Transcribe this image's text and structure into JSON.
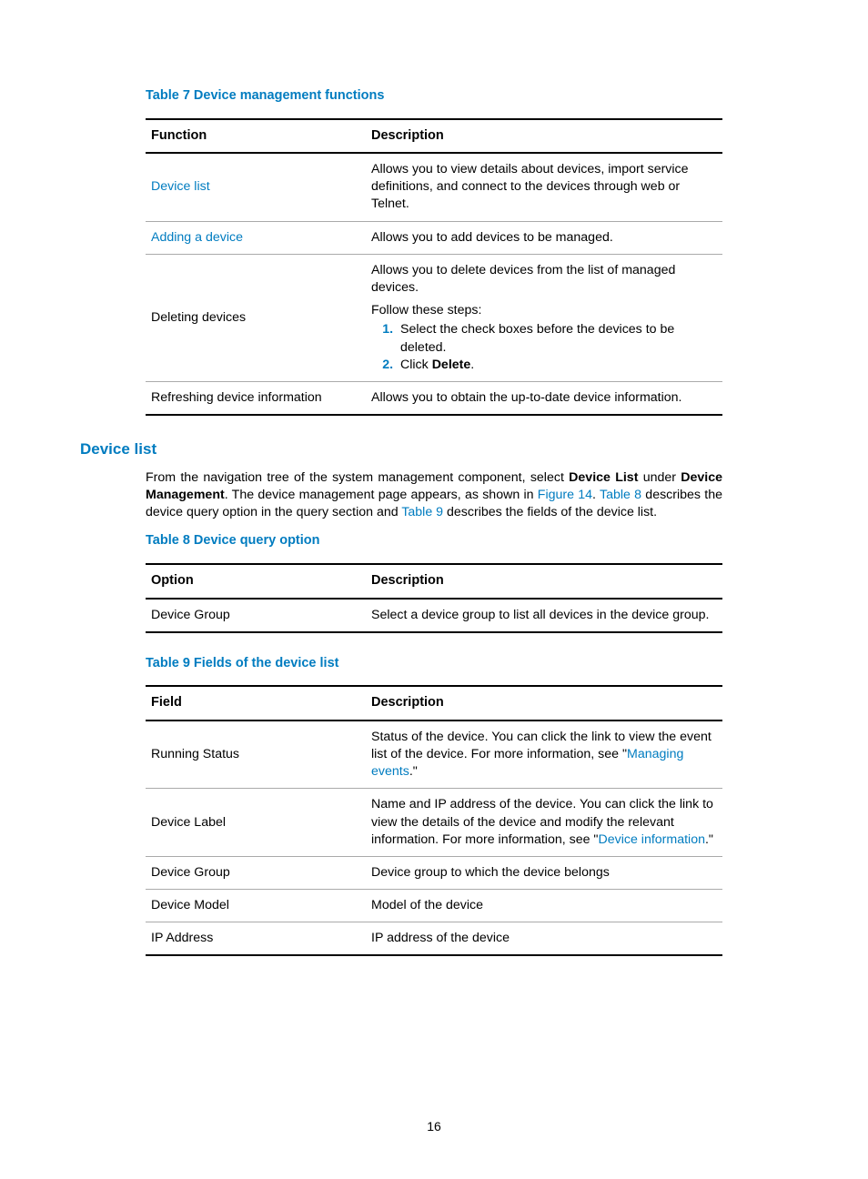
{
  "table7": {
    "caption": "Table 7 Device management functions",
    "headers": {
      "c1": "Function",
      "c2": "Description"
    },
    "rows": [
      {
        "func_link": "Device list",
        "desc": "Allows you to view details about devices, import service definitions, and connect to the devices through web or Telnet."
      },
      {
        "func_link": "Adding a device",
        "desc": "Allows you to add devices to be managed."
      },
      {
        "func_text": "Deleting devices",
        "desc1": "Allows you to delete devices from the list of managed devices.",
        "desc2": "Follow these steps:",
        "step1": "Select the check boxes before the devices to be deleted.",
        "step2_pre": "Click ",
        "step2_b": "Delete",
        "step2_post": "."
      },
      {
        "func_text": "Refreshing device information",
        "desc": "Allows you to obtain the up-to-date device information."
      }
    ]
  },
  "section_heading": "Device list",
  "para": {
    "t1": "From the navigation tree of the system management component, select ",
    "b1": "Device List",
    "t2": " under ",
    "b2": "Device Management",
    "t3": ". The device management page appears, as shown in ",
    "l1": "Figure 14",
    "t4": ". ",
    "l2": "Table 8",
    "t5": " describes the device query option in the query section and ",
    "l3": "Table 9",
    "t6": " describes the fields of the device list."
  },
  "table8": {
    "caption": "Table 8 Device query option",
    "headers": {
      "c1": "Option",
      "c2": "Description"
    },
    "rows": [
      {
        "opt": "Device Group",
        "desc": "Select a device group to list all devices in the device group."
      }
    ]
  },
  "table9": {
    "caption": "Table 9 Fields of the device list",
    "headers": {
      "c1": "Field",
      "c2": "Description"
    },
    "rows": [
      {
        "field": "Running Status",
        "d1": "Status of the device. You can click the link to view the event list of the device. For more information, see \"",
        "l1": "Managing events",
        "d2": ".\""
      },
      {
        "field": "Device Label",
        "d1": "Name and IP address of the device. You can click the link to view the details of the device and modify the relevant information. For more information, see \"",
        "l1": "Device information",
        "d2": ".\""
      },
      {
        "field": "Device Group",
        "desc": "Device group to which the device belongs"
      },
      {
        "field": "Device Model",
        "desc": "Model of the device"
      },
      {
        "field": "IP Address",
        "desc": "IP address of the device"
      }
    ]
  },
  "page_number": "16"
}
